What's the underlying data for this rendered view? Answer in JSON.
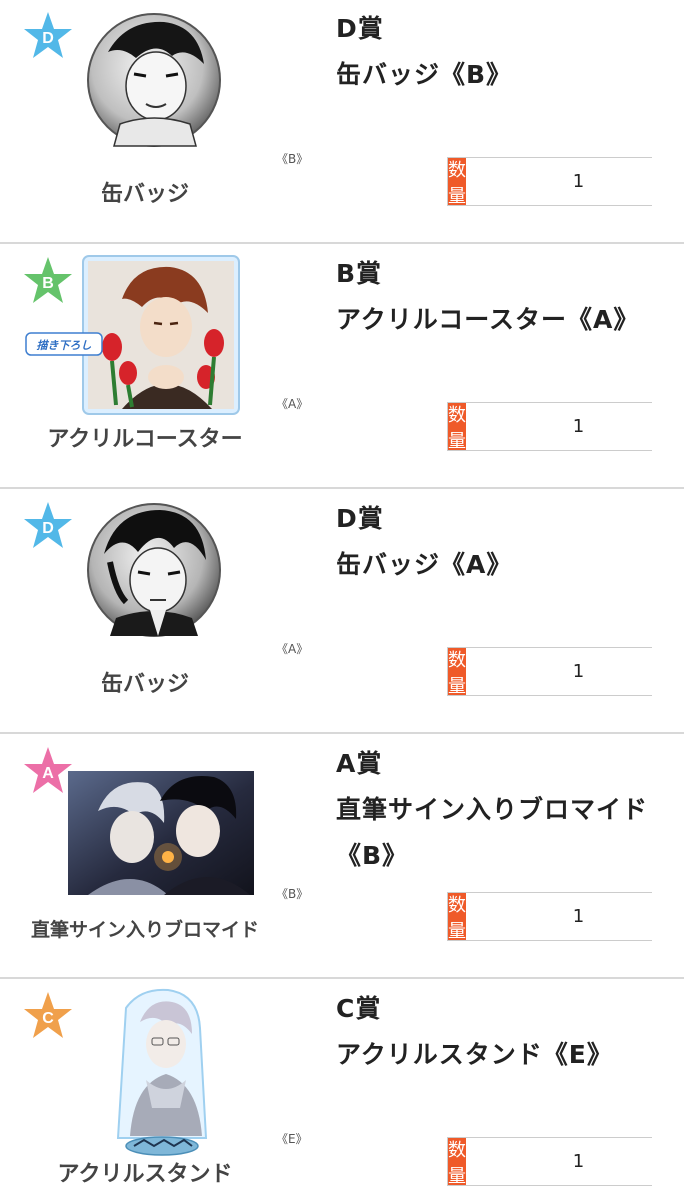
{
  "colors": {
    "accent": "#ef5a29",
    "divider": "#d8d8d8"
  },
  "items": [
    {
      "rank": "D賞",
      "name": "缶バッジ《B》",
      "badge_letter": "D",
      "badge_color": "#52b8e8",
      "variant": "《B》",
      "caption": "缶バッジ",
      "art_type": "badge",
      "qty_label": "数量",
      "qty_value": "1"
    },
    {
      "rank": "B賞",
      "name": "アクリルコースター《A》",
      "badge_letter": "B",
      "badge_color": "#65c36b",
      "variant": "《A》",
      "caption": "アクリルコースター",
      "ribbon": "描き下ろし",
      "art_type": "coaster",
      "qty_label": "数量",
      "qty_value": "1"
    },
    {
      "rank": "D賞",
      "name": "缶バッジ《A》",
      "badge_letter": "D",
      "badge_color": "#52b8e8",
      "variant": "《A》",
      "caption": "缶バッジ",
      "art_type": "badge",
      "qty_label": "数量",
      "qty_value": "1"
    },
    {
      "rank": "A賞",
      "name": "直筆サイン入りブロマイド《B》",
      "badge_letter": "A",
      "badge_color": "#ec6fa7",
      "variant": "《B》",
      "caption": "直筆サイン入りブロマイド",
      "art_type": "bromide",
      "qty_label": "数量",
      "qty_value": "1"
    },
    {
      "rank": "C賞",
      "name": "アクリルスタンド《E》",
      "badge_letter": "C",
      "badge_color": "#f0a04b",
      "variant": "《E》",
      "caption": "アクリルスタンド",
      "art_type": "stand",
      "qty_label": "数量",
      "qty_value": "1"
    }
  ]
}
